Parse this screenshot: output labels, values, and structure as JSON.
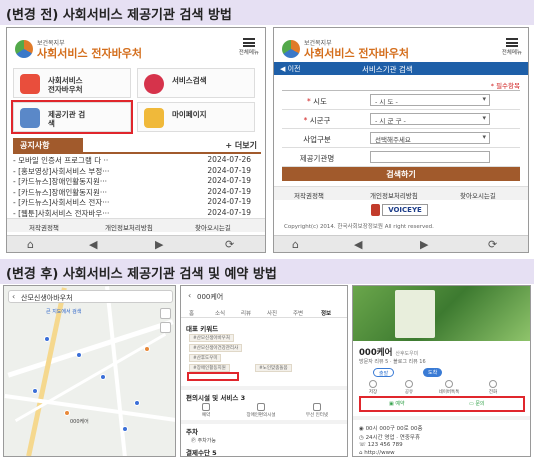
{
  "banners": {
    "before": "(변경 전) 사회서비스 제공기관 검색 방법",
    "after": "(변경 후) 사회서비스 제공기관 검색 및 예약 방법"
  },
  "brand": {
    "ministry": "보건복지부",
    "name": "사회서비스 전자바우처",
    "all_menu": "전체메뉴"
  },
  "before_home": {
    "tiles": [
      {
        "label": "사회서비스\n전자바우처",
        "icon": "voucher-card-icon"
      },
      {
        "label": "서비스검색",
        "icon": "service-search-icon"
      },
      {
        "label": "제공기관 검\n색",
        "icon": "provider-search-icon"
      },
      {
        "label": "마이페이지",
        "icon": "mypage-icon"
      }
    ],
    "notice_tab": "공지사항",
    "more": "+ 더보기",
    "notices": [
      {
        "title": "- 모바일 인증서 프로그램 다 ··",
        "date": "2024-07-26"
      },
      {
        "title": "- [홍보영상]사회서비스 부정···",
        "date": "2024-07-19"
      },
      {
        "title": "- [카드뉴스]장애인활동지원···",
        "date": "2024-07-19"
      },
      {
        "title": "- [카드뉴스]장애인활동지원···",
        "date": "2024-07-19"
      },
      {
        "title": "- [카드뉴스]사회서비스 전자···",
        "date": "2024-07-19"
      },
      {
        "title": "- [웹툰]사회서비스 전자바우···",
        "date": "2024-07-19"
      }
    ],
    "footer_links": [
      "저작권정책",
      "개인정보처리방침",
      "찾아오시는길"
    ]
  },
  "before_search": {
    "back": "◀ 이전",
    "title": "서비스기관 검색",
    "required_note": "* 필수항목",
    "fields": [
      {
        "label": "시도",
        "required": true,
        "value": "- 시 도 -",
        "type": "select"
      },
      {
        "label": "시군구",
        "required": true,
        "value": "- 시 군 구 -",
        "type": "select"
      },
      {
        "label": "사업구분",
        "required": false,
        "value": "선택해주세요",
        "type": "select"
      },
      {
        "label": "제공기관명",
        "required": false,
        "value": "",
        "type": "input"
      }
    ],
    "search_button": "검색하기",
    "footer_links": [
      "저작권정책",
      "개인정보처리방침",
      "찾아오시는길"
    ],
    "voice_logo": "VOICEYE",
    "copyright": "Copyright(c) 2014. 한국사회보장정보원 All right reserved."
  },
  "after_map": {
    "search_text": "산모신생아바우처",
    "labels": [
      "000케어",
      "큰 지도에서 검색"
    ]
  },
  "after_detail": {
    "search_text": "000케어",
    "tabs": [
      "홈",
      "소식",
      "리뷰",
      "사진",
      "주변",
      "정보"
    ],
    "keywords_title": "대표 키워드",
    "keywords": [
      "#산모신생아바우처",
      "#산모신생아건강관리사",
      "#산후도우미",
      "#장애인활동지원",
      "#노인맞춤돌봄"
    ],
    "facilities_title": "편의시설 및 서비스 3",
    "facilities": [
      "예약",
      "장애인편의시설",
      "무선 인터넷"
    ],
    "parking_title": "주차",
    "parking": "주차가능",
    "payment_title": "결제수단 5"
  },
  "after_place": {
    "name": "000케어",
    "category": "산후도우미",
    "sub": "방문자 리뷰 5 · 블로그 리뷰 16",
    "pills": [
      "출발",
      "도착"
    ],
    "actions": [
      "저장",
      "공유",
      "네이버톡톡",
      "전화"
    ],
    "book": "예약",
    "inquire": "문의",
    "address": "00시 000구 00로 00층",
    "hours": "24시간 영업 · 연중무휴",
    "phone": "123 456 789",
    "homepage": "http://www"
  }
}
